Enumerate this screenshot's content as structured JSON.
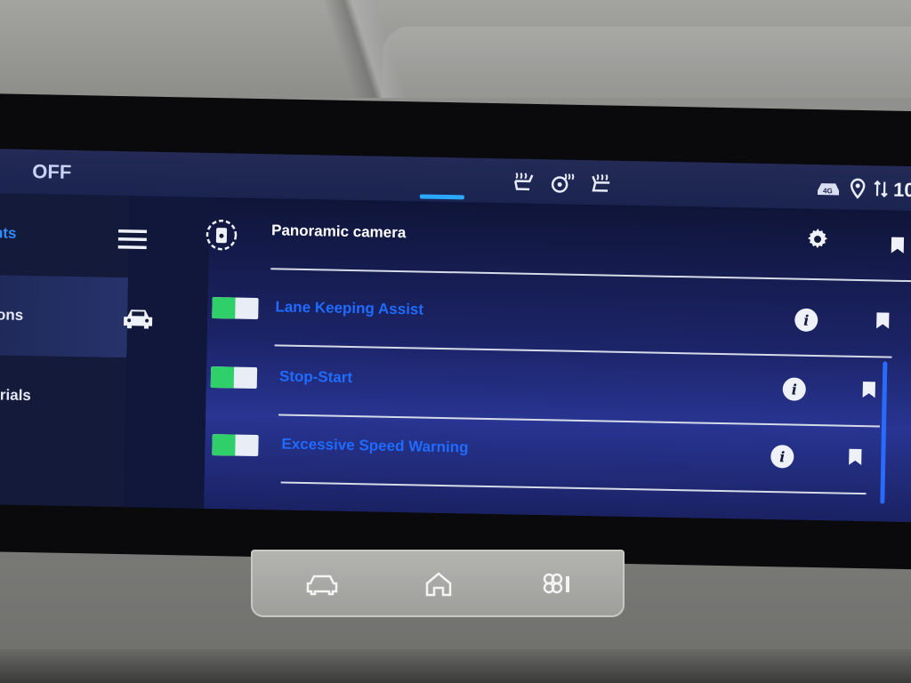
{
  "status": {
    "mode_text": "OFF",
    "time_partial": "10:",
    "icons": [
      "seat-heat-left-icon",
      "steering-heat-icon",
      "seat-heat-right-icon",
      "4g-icon",
      "location-icon",
      "signal-icon"
    ]
  },
  "sidebar": {
    "items": [
      {
        "label": "nts",
        "active": true
      },
      {
        "label": "ions",
        "active": false
      },
      {
        "label": "orials",
        "active": false
      }
    ]
  },
  "list": {
    "header": {
      "label": "Panoramic camera"
    },
    "rows": [
      {
        "label": "Lane Keeping Assist",
        "enabled": true
      },
      {
        "label": "Stop-Start",
        "enabled": true
      },
      {
        "label": "Excessive Speed Warning",
        "enabled": true
      }
    ]
  },
  "hardware_buttons": [
    {
      "name": "car-menu-button",
      "icon": "car-icon"
    },
    {
      "name": "home-button",
      "icon": "home-icon"
    },
    {
      "name": "climate-button",
      "icon": "fan-icon"
    }
  ],
  "colors": {
    "accent": "#1f6bff",
    "toggle_on": "#2fd06a",
    "status_indicator": "#2aa8ff"
  }
}
